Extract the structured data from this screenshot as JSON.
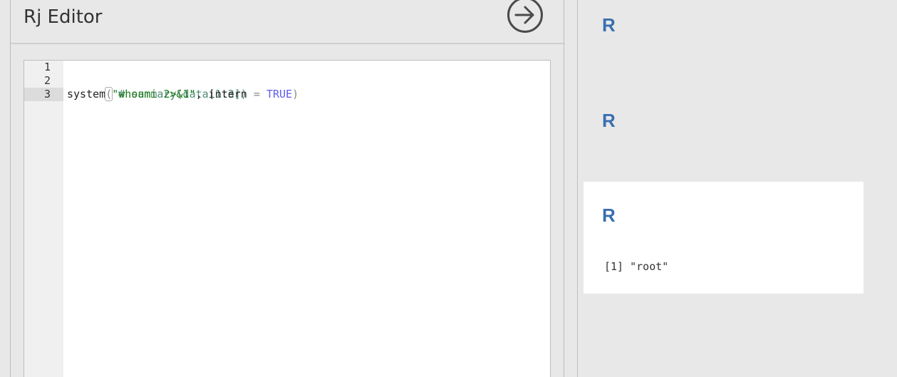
{
  "editor": {
    "title": "Rj Editor",
    "run_icon": "arrow-right-circle-icon",
    "lines": [
      {
        "number": "1",
        "tokens": []
      },
      {
        "number": "2",
        "tokens": [
          {
            "type": "comment",
            "text": "# summary(data[1:3])"
          }
        ]
      },
      {
        "number": "3",
        "tokens": [
          {
            "type": "plain",
            "text": "system"
          },
          {
            "type": "paren-match",
            "text": "("
          },
          {
            "type": "string",
            "text": "\"whoami 2>&1\""
          },
          {
            "type": "plain",
            "text": ", intern "
          },
          {
            "type": "op",
            "text": "="
          },
          {
            "type": "plain",
            "text": " "
          },
          {
            "type": "bool",
            "text": "TRUE"
          },
          {
            "type": "paren",
            "text": ")"
          }
        ]
      }
    ],
    "active_line": "3"
  },
  "output": {
    "blocks": [
      {
        "label": "R"
      },
      {
        "label": "R"
      }
    ],
    "result_card": {
      "label": "R",
      "text": "[1] \"root\""
    }
  },
  "colors": {
    "r_label": "#3a6fb0",
    "string": "#1a7a1a",
    "comment": "#4e8c72",
    "bool": "#5b5bf0"
  }
}
